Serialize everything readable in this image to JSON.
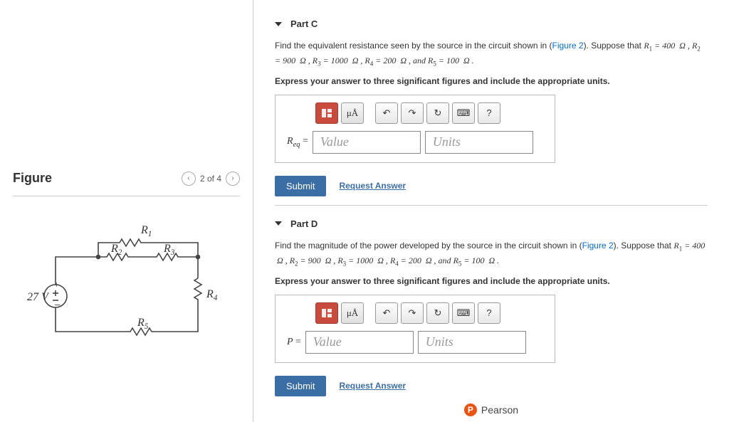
{
  "figure": {
    "title": "Figure",
    "nav_text": "2 of 4",
    "source_voltage": "27 V",
    "resistors": {
      "R1": "R₁",
      "R2": "R₂",
      "R3": "R₃",
      "R4": "R₄",
      "R5": "R₅"
    }
  },
  "toolbar": {
    "template_btn": "▭",
    "special_chars_btn": "μÅ",
    "undo_btn": "↶",
    "redo_btn": "↷",
    "reset_btn": "↻",
    "keyboard_btn": "⌨",
    "help_btn": "?"
  },
  "common": {
    "submit_label": "Submit",
    "request_answer_label": "Request Answer",
    "value_placeholder": "Value",
    "units_placeholder": "Units",
    "figure_link_text": "Figure 2"
  },
  "partC": {
    "heading": "Part C",
    "prompt_pre": "Find the equivalent resistance seen by the source in the circuit shown in (",
    "prompt_post": "). Suppose that ",
    "givens": "R₁ = 400  Ω , R₂ = 900  Ω , R₃ = 1000  Ω , R₄ = 200  Ω , and R₅ = 100  Ω .",
    "instruction": "Express your answer to three significant figures and include the appropriate units.",
    "var_label": "Rₑq ="
  },
  "partD": {
    "heading": "Part D",
    "prompt_pre": "Find the magnitude of the power developed by the source in the circuit shown in (",
    "prompt_post": "). Suppose that ",
    "givens": "R₁ = 400  Ω , R₂ = 900  Ω , R₃ = 1000  Ω , R₄ = 200  Ω , and R₅ = 100  Ω .",
    "instruction": "Express your answer to three significant figures and include the appropriate units.",
    "var_label": "P ="
  },
  "chart_data": {
    "type": "diagram",
    "description": "Electrical circuit: 27 V source in series with parallel/series resistor network",
    "source_voltage_V": 27,
    "resistors_ohm": {
      "R1": 400,
      "R2": 900,
      "R3": 1000,
      "R4": 200,
      "R5": 100
    },
    "topology": "Source + to node A. R1 from A to B (top). R2 and R3 in series from A to B (middle). R4 from B to node C. R5 from C back to source −."
  },
  "footer": {
    "brand": "Pearson",
    "logo_letter": "P"
  }
}
